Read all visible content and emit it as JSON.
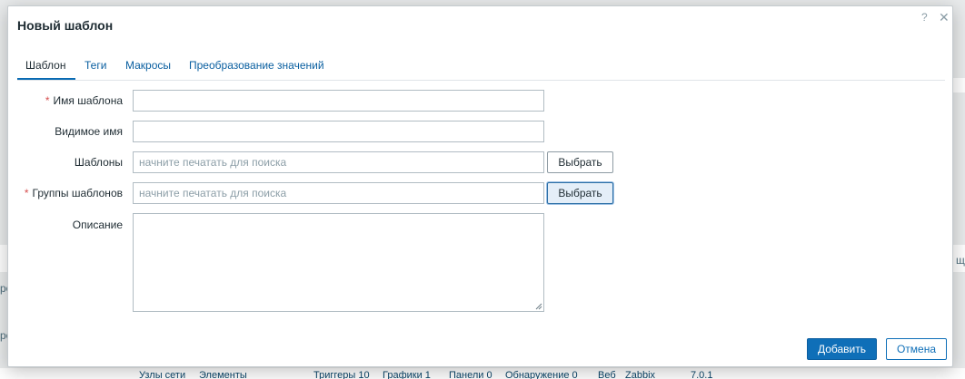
{
  "background": {
    "left_fragments": [
      "ро",
      "ро"
    ],
    "right_fragment": "щ",
    "bottom_links": [
      "Узлы сети",
      "Элементы",
      "Триггеры 10",
      "Графики 1",
      "Панели 0",
      "Обнаружение 0",
      "Веб",
      "Zabbix",
      "7.0.1"
    ]
  },
  "dialog": {
    "title": "Новый шаблон",
    "help_glyph": "?",
    "close_glyph": "✕"
  },
  "tabs": [
    "Шаблон",
    "Теги",
    "Макросы",
    "Преобразование значений"
  ],
  "form": {
    "required_mark": "*",
    "template_name_label": "Имя шаблона",
    "template_name_value": "",
    "visible_name_label": "Видимое имя",
    "visible_name_value": "",
    "templates_label": "Шаблоны",
    "templates_placeholder": "начните печатать для поиска",
    "templates_select": "Выбрать",
    "groups_label": "Группы шаблонов",
    "groups_placeholder": "начните печатать для поиска",
    "groups_select": "Выбрать",
    "description_label": "Описание",
    "description_value": ""
  },
  "footer": {
    "add_label": "Добавить",
    "cancel_label": "Отмена"
  },
  "colors": {
    "primary": "#0f6fb8",
    "required": "#d64e4e",
    "link": "#0a5fa0"
  }
}
